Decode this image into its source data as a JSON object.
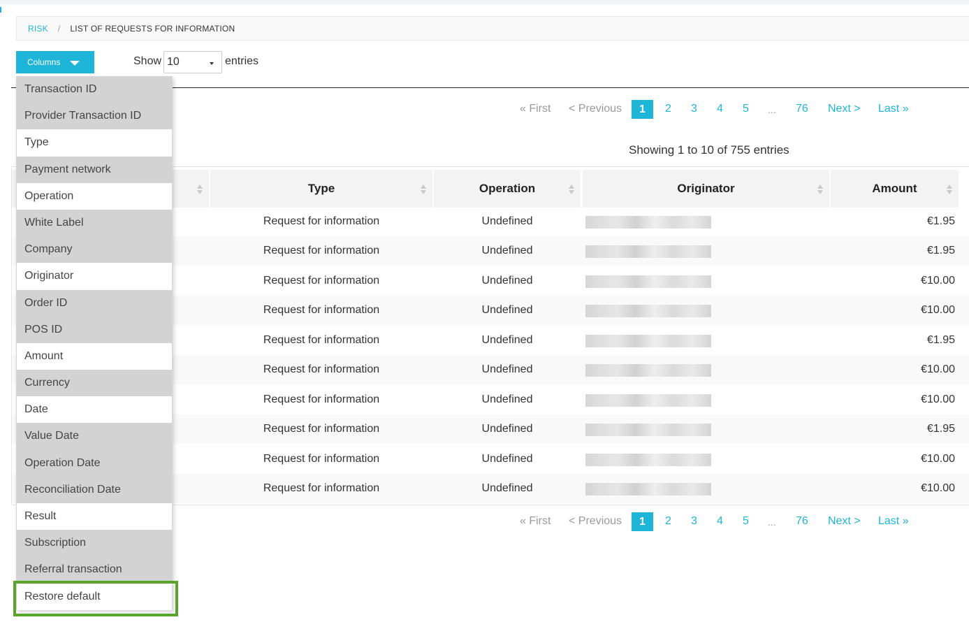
{
  "breadcrumb": {
    "parent": "RISK",
    "separator": "/",
    "current": "LIST OF REQUESTS FOR INFORMATION"
  },
  "toolbar": {
    "columns_label": "Columns",
    "show_label": "Show",
    "entries_value": "10",
    "entries_label": "entries"
  },
  "pagination": {
    "first": "« First",
    "previous": "< Previous",
    "pages": [
      "1",
      "2",
      "3",
      "4",
      "5"
    ],
    "ellipsis": "...",
    "last_page": "76",
    "next": "Next >",
    "last": "Last »",
    "current_page": "1"
  },
  "summary": "Showing 1 to 10 of 755 entries",
  "table": {
    "headers": {
      "type": "Type",
      "operation": "Operation",
      "originator": "Originator",
      "amount": "Amount"
    },
    "rows": [
      {
        "type": "Request for information",
        "operation": "Undefined",
        "amount": "€1.95"
      },
      {
        "type": "Request for information",
        "operation": "Undefined",
        "amount": "€1.95"
      },
      {
        "type": "Request for information",
        "operation": "Undefined",
        "amount": "€10.00"
      },
      {
        "type": "Request for information",
        "operation": "Undefined",
        "amount": "€10.00"
      },
      {
        "type": "Request for information",
        "operation": "Undefined",
        "amount": "€1.95"
      },
      {
        "type": "Request for information",
        "operation": "Undefined",
        "amount": "€10.00"
      },
      {
        "type": "Request for information",
        "operation": "Undefined",
        "amount": "€10.00"
      },
      {
        "type": "Request for information",
        "operation": "Undefined",
        "amount": "€1.95"
      },
      {
        "type": "Request for information",
        "operation": "Undefined",
        "amount": "€10.00"
      },
      {
        "type": "Request for information",
        "operation": "Undefined",
        "amount": "€10.00"
      }
    ]
  },
  "column_menu": {
    "items": [
      {
        "label": "Transaction ID",
        "visible": true
      },
      {
        "label": "Provider Transaction ID",
        "visible": true
      },
      {
        "label": "Type",
        "visible": false
      },
      {
        "label": "Payment network",
        "visible": true
      },
      {
        "label": "Operation",
        "visible": false
      },
      {
        "label": "White Label",
        "visible": true
      },
      {
        "label": "Company",
        "visible": true
      },
      {
        "label": "Originator",
        "visible": false
      },
      {
        "label": "Order ID",
        "visible": true
      },
      {
        "label": "POS ID",
        "visible": true
      },
      {
        "label": "Amount",
        "visible": false
      },
      {
        "label": "Currency",
        "visible": true
      },
      {
        "label": "Date",
        "visible": false
      },
      {
        "label": "Value Date",
        "visible": true
      },
      {
        "label": "Operation Date",
        "visible": true
      },
      {
        "label": "Reconciliation Date",
        "visible": true
      },
      {
        "label": "Result",
        "visible": false
      },
      {
        "label": "Subscription",
        "visible": true
      },
      {
        "label": "Referral transaction",
        "visible": true
      }
    ],
    "restore_label": "Restore default"
  },
  "colors": {
    "accent": "#1fb5d8",
    "highlight": "#5aa42c",
    "selected_item": "#d3d3d3"
  }
}
